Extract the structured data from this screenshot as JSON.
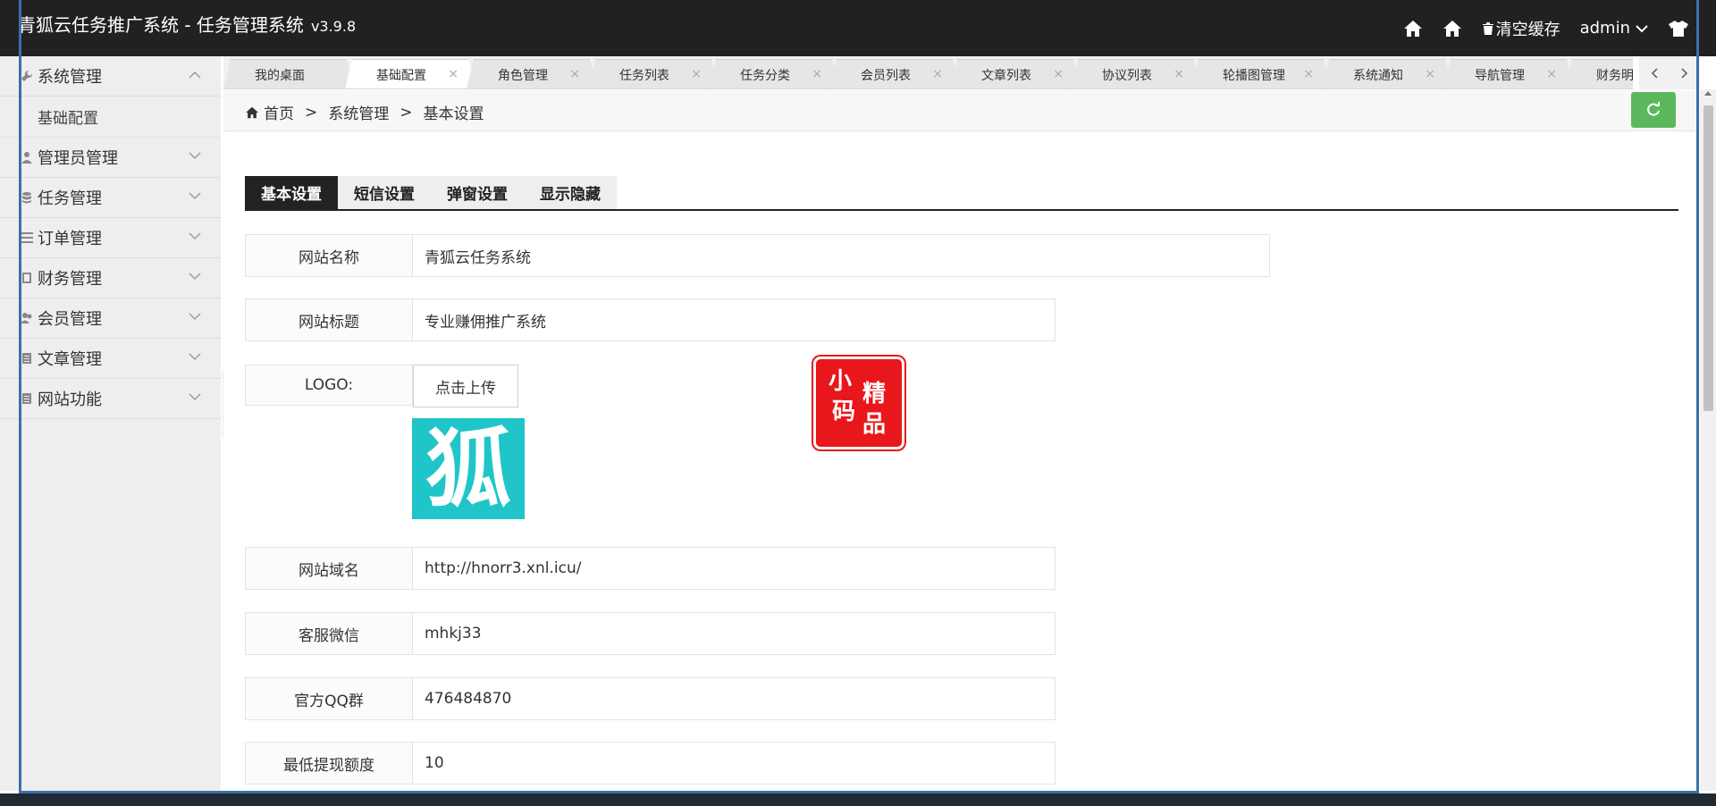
{
  "header": {
    "title": "青狐云任务推广系统 - 任务管理系统",
    "version": "v3.9.8",
    "clear_cache": "清空缓存",
    "user": "admin"
  },
  "sidebar": {
    "items": [
      {
        "label": "系统管理",
        "icon": "wrench-icon",
        "expanded": true
      },
      {
        "label": "管理员管理",
        "icon": "user-icon"
      },
      {
        "label": "任务管理",
        "icon": "database-icon"
      },
      {
        "label": "订单管理",
        "icon": "list-icon"
      },
      {
        "label": "财务管理",
        "icon": "book-icon"
      },
      {
        "label": "会员管理",
        "icon": "users-icon"
      },
      {
        "label": "文章管理",
        "icon": "file-icon"
      },
      {
        "label": "网站功能",
        "icon": "file-icon"
      }
    ],
    "sub_items": [
      "基础配置"
    ]
  },
  "tabs": [
    {
      "label": "我的桌面"
    },
    {
      "label": "基础配置",
      "active": true
    },
    {
      "label": "角色管理"
    },
    {
      "label": "任务列表"
    },
    {
      "label": "任务分类"
    },
    {
      "label": "会员列表"
    },
    {
      "label": "文章列表"
    },
    {
      "label": "协议列表"
    },
    {
      "label": "轮播图管理"
    },
    {
      "label": "系统通知"
    },
    {
      "label": "导航管理"
    },
    {
      "label": "财务明"
    }
  ],
  "tab_close_glyph": "×",
  "breadcrumb": {
    "home": "首页",
    "level1": "系统管理",
    "level2": "基本设置",
    "sep": ">"
  },
  "settings_tabs": [
    "基本设置",
    "短信设置",
    "弹窗设置",
    "显示隐藏"
  ],
  "form": {
    "site_name": {
      "label": "网站名称",
      "value": "青狐云任务系统"
    },
    "site_title": {
      "label": "网站标题",
      "value": "专业赚佣推广系统"
    },
    "logo": {
      "label": "LOGO:",
      "button": "点击上传",
      "image_text": "狐"
    },
    "site_domain": {
      "label": "网站域名",
      "value": "http://hnorr3.xnl.icu/"
    },
    "service_wechat": {
      "label": "客服微信",
      "value": "mhkj33"
    },
    "qq_group": {
      "label": "官方QQ群",
      "value": "476484870"
    },
    "min_withdraw": {
      "label": "最低提现额度",
      "value": "10"
    }
  },
  "watermark": {
    "chars": [
      "小",
      "精",
      "码",
      "品"
    ]
  },
  "colors": {
    "header_bg": "#212121",
    "accent_green": "#5cb85c",
    "logo_bg": "#1fc5c9",
    "seal_red": "#e8171b",
    "frame_blue": "#3c6fa8"
  }
}
